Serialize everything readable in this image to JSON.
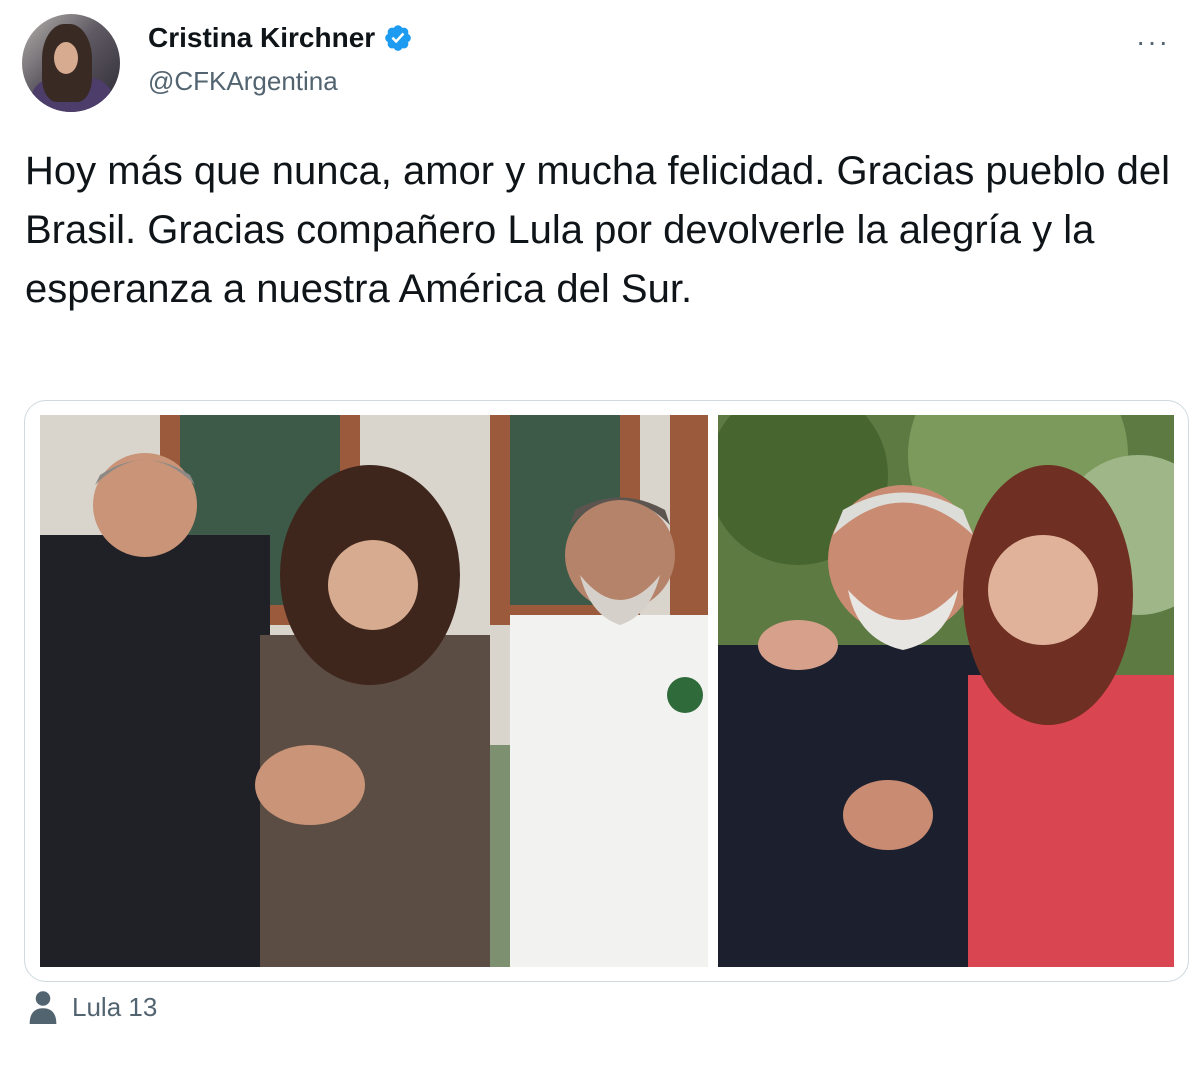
{
  "author": {
    "display_name": "Cristina Kirchner",
    "handle": "@CFKArgentina",
    "verified": true,
    "avatar_icon": "profile-photo"
  },
  "menu": {
    "label": "···",
    "icon": "more-icon"
  },
  "tweet": {
    "text": "Hoy más que nunca, amor y mucha felicidad. Gracias pueblo del Brasil. Gracias compañero Lula por devolverle la alegría y la esperanza a nuestra América del Sur."
  },
  "media": {
    "photo_count": 2
  },
  "footer": {
    "icon": "person-icon",
    "label": "Lula 13"
  },
  "colors": {
    "text_primary": "#0f1419",
    "text_secondary": "#536471",
    "verified_blue": "#1d9bf0",
    "border": "#cfd9de"
  }
}
